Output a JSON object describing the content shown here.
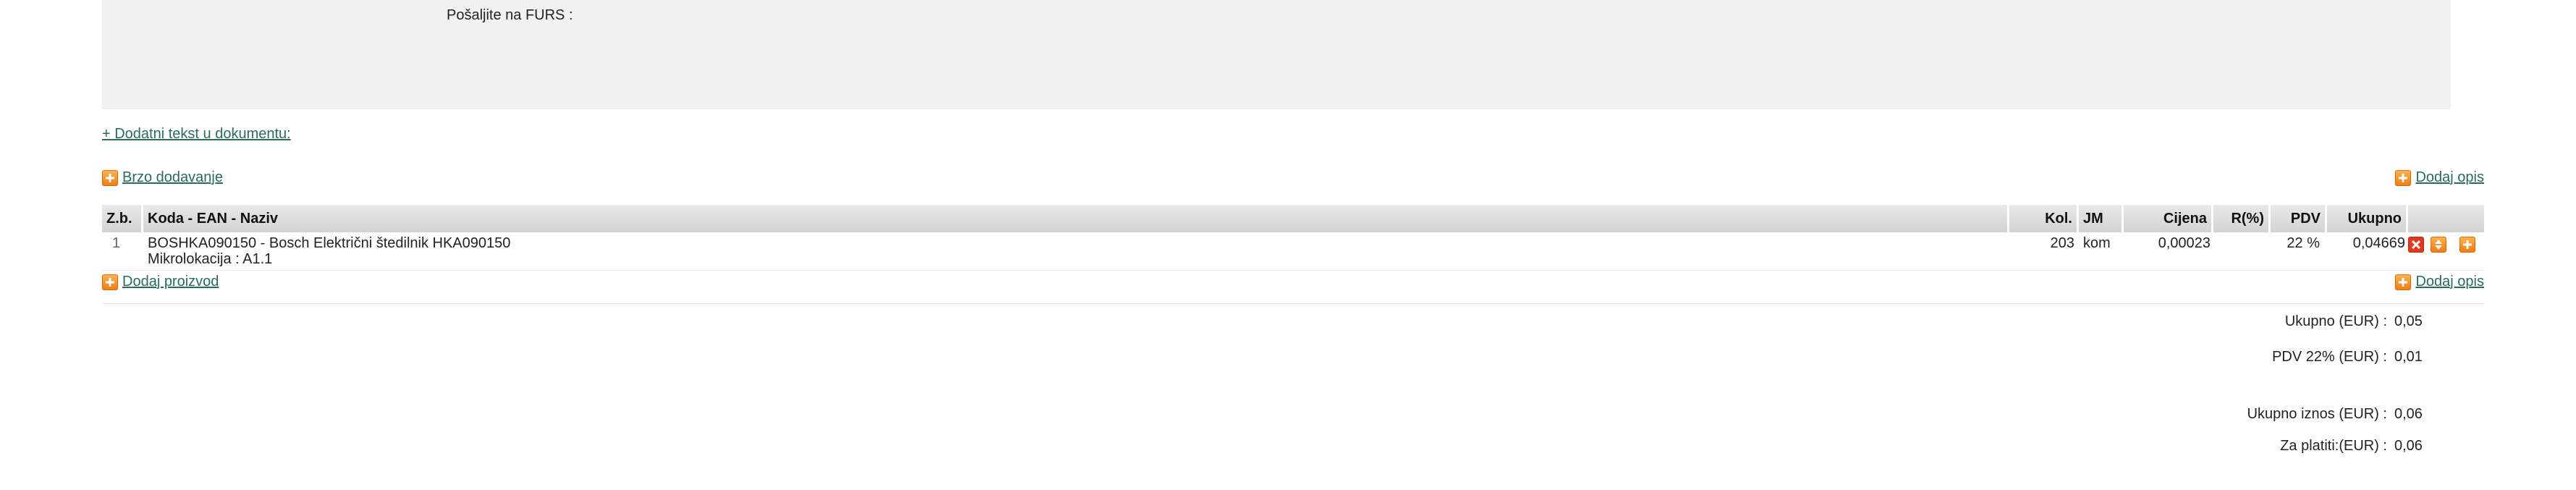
{
  "header": {
    "furs_label": "Pošaljite na FURS :"
  },
  "links": {
    "additional_text": "+ Dodatni tekst u dokumentu:",
    "quick_add": "Brzo dodavanje",
    "add_description": "Dodaj opis",
    "add_product": "Dodaj proizvod",
    "add_description_bottom": "Dodaj opis"
  },
  "table": {
    "columns": {
      "zb": "Z.b.",
      "code": "Koda - EAN - Naziv",
      "qty": "Kol.",
      "unit": "JM",
      "price": "Cijena",
      "discount": "R(%)",
      "vat": "PDV",
      "total": "Ukupno"
    },
    "rows": [
      {
        "zb": "1",
        "name": "BOSHKA090150 - Bosch Električni štedilnik HKA090150",
        "location": "Mikrolokacija : A1.1",
        "qty": "203",
        "unit": "kom",
        "price": "0,00023",
        "discount": "",
        "vat": "22 %",
        "total": "0,04669"
      }
    ]
  },
  "totals": {
    "subtotal_label": "Ukupno (EUR) :",
    "subtotal_value": "0,05",
    "vat_label": "PDV 22% (EUR) :",
    "vat_value": "0,01",
    "grand_label": "Ukupno iznos (EUR) :",
    "grand_value": "0,06",
    "pay_label": "Za platiti:(EUR) :",
    "pay_value": "0,06"
  },
  "icons": {
    "plus": "plus-icon",
    "delete": "delete-icon",
    "move": "move-icon"
  },
  "colors": {
    "link": "#2a6b5e",
    "accent_orange": "#f07d12",
    "delete_red": "#e03a1e",
    "panel_gray": "#f1f1f1"
  }
}
